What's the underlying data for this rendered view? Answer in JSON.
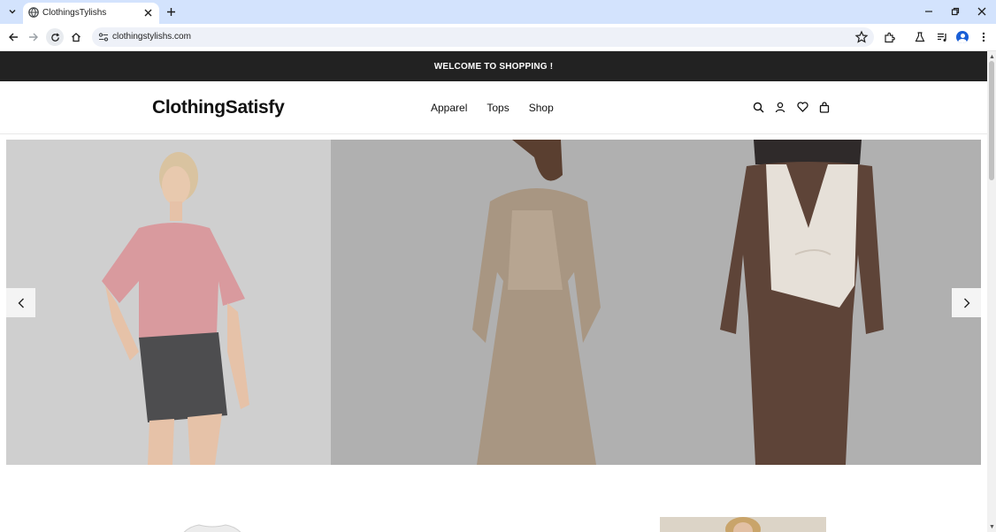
{
  "browser": {
    "tab_title": "ClothingsTylishs",
    "url": "clothingstylishs.com"
  },
  "site": {
    "announcement": "WELCOME TO SHOPPING !",
    "logo": "ClothingSatisfy",
    "nav": [
      "Apparel",
      "Tops",
      "Shop"
    ],
    "header_icons": [
      "search-icon",
      "account-icon",
      "wishlist-heart-icon",
      "cart-bag-icon"
    ]
  },
  "colors": {
    "announcement_bg": "#222222",
    "tabbar_bg": "#d3e3fd"
  }
}
